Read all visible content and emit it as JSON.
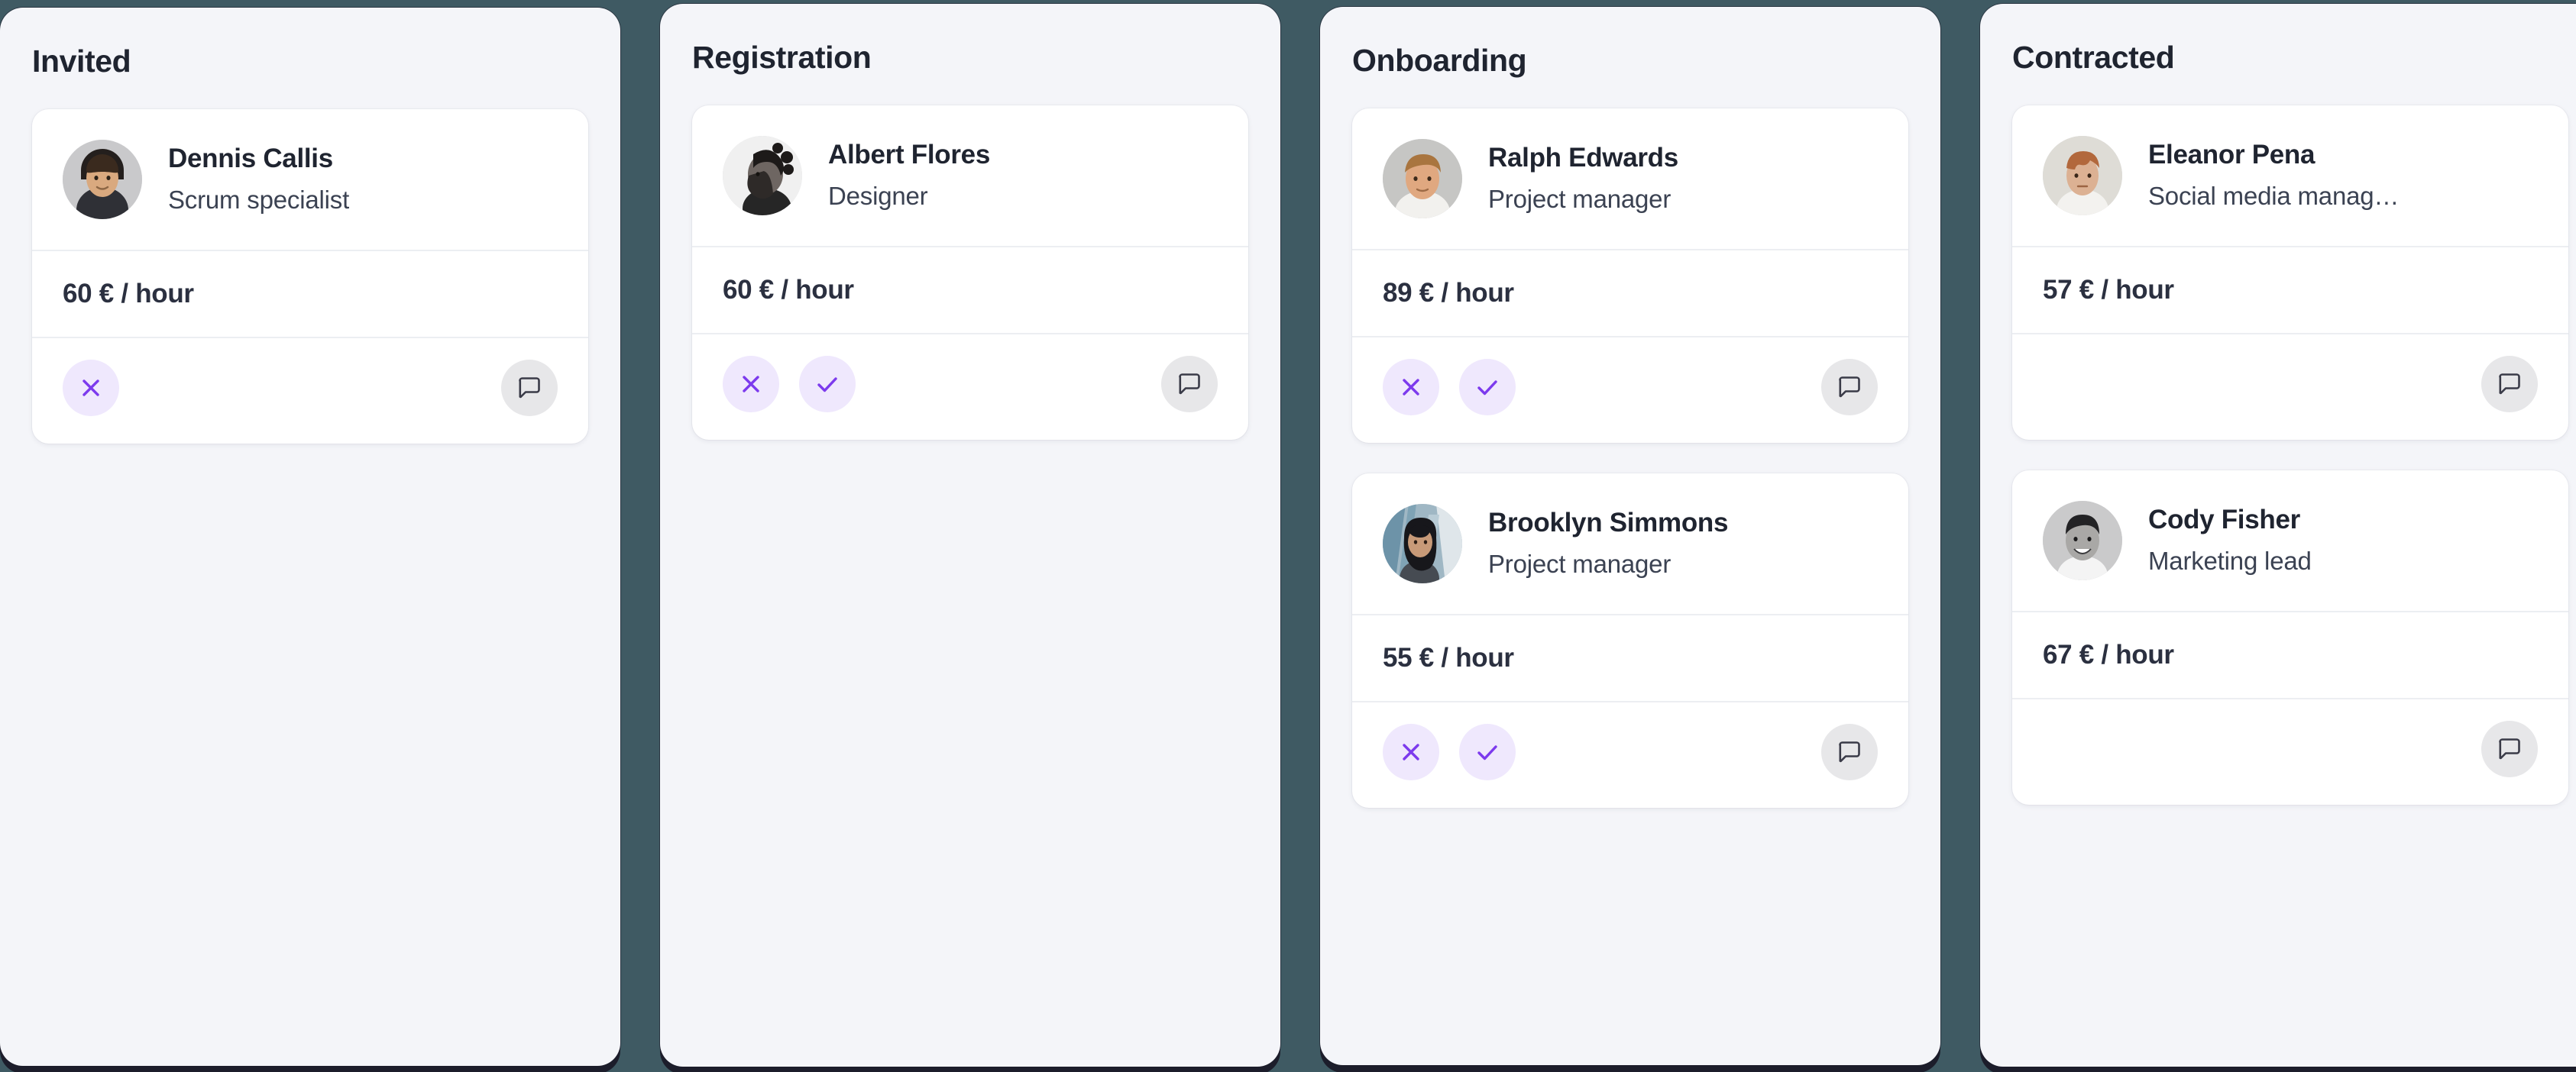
{
  "colors": {
    "page_background": "#3f5a63",
    "column_background": "#f4f5f9",
    "card_background": "#ffffff",
    "accent_purple": "#7c3aed",
    "accent_purple_soft": "#efe8fd",
    "icon_grey_bg": "#e7e7e9",
    "text_primary": "#1f2430",
    "text_secondary": "#3b4252",
    "divider": "#eceef2"
  },
  "columns": [
    {
      "title": "Invited",
      "cards": [
        {
          "name": "Dennis Callis",
          "role": "Scrum specialist",
          "rate": "60 € / hour",
          "actions": {
            "reject": "reject-icon",
            "accept": null,
            "comment": "comment-icon"
          }
        }
      ]
    },
    {
      "title": "Registration",
      "cards": [
        {
          "name": "Albert Flores",
          "role": "Designer",
          "rate": "60 € / hour",
          "actions": {
            "reject": "reject-icon",
            "accept": "accept-icon",
            "comment": "comment-icon"
          }
        }
      ]
    },
    {
      "title": "Onboarding",
      "cards": [
        {
          "name": "Ralph Edwards",
          "role": "Project manager",
          "rate": "89 € / hour",
          "actions": {
            "reject": "reject-icon",
            "accept": "accept-icon",
            "comment": "comment-icon"
          }
        },
        {
          "name": "Brooklyn Simmons",
          "role": "Project manager",
          "rate": "55 € / hour",
          "actions": {
            "reject": "reject-icon",
            "accept": "accept-icon",
            "comment": "comment-icon"
          }
        }
      ]
    },
    {
      "title": "Contracted",
      "cards": [
        {
          "name": "Eleanor Pena",
          "role": "Social media manag…",
          "rate": "57 € / hour",
          "actions": {
            "reject": null,
            "accept": null,
            "comment": "comment-icon"
          }
        },
        {
          "name": "Cody Fisher",
          "role": "Marketing lead",
          "rate": "67 € / hour",
          "actions": {
            "reject": null,
            "accept": null,
            "comment": "comment-icon"
          }
        }
      ]
    }
  ]
}
